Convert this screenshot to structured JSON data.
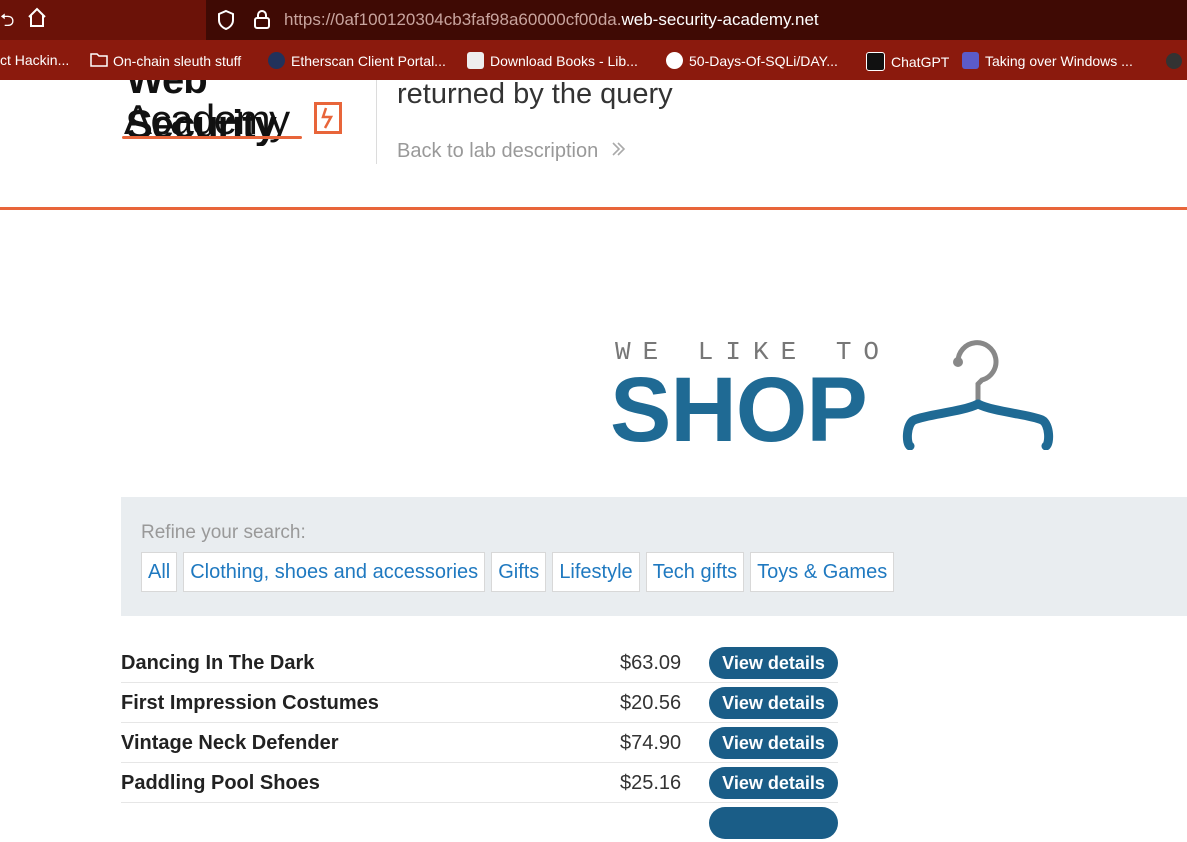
{
  "browser": {
    "url_prefix": "https://0af100120304cb3faf98a60000cf00da.",
    "url_domain": "web-security-academy.net",
    "bookmarks": [
      {
        "label": "ct Hackin...",
        "icon": "none"
      },
      {
        "label": "On-chain sleuth stuff",
        "icon": "folder-icon"
      },
      {
        "label": "Etherscan Client Portal...",
        "icon": "etherscan-icon"
      },
      {
        "label": "Download Books - Lib...",
        "icon": "library-icon"
      },
      {
        "label": "50-Days-Of-SQLi/DAY...",
        "icon": "github-icon"
      },
      {
        "label": "ChatGPT",
        "icon": "chatgpt-icon"
      },
      {
        "label": "Taking over Windows ...",
        "icon": "bookmark-site-icon"
      }
    ]
  },
  "header": {
    "logo_line1": "Web Security",
    "logo_line2": "Academy",
    "lab_title": "returned by the query",
    "back_link": "Back to lab description",
    "back_link_icon": "double-chevron-right-icon"
  },
  "banner": {
    "tagline": "WE LIKE TO",
    "shop": "SHOP"
  },
  "filters": {
    "label": "Refine your search:",
    "categories": [
      "All",
      "Clothing, shoes and accessories",
      "Gifts",
      "Lifestyle",
      "Tech gifts",
      "Toys & Games"
    ]
  },
  "products": [
    {
      "name": "Dancing In The Dark",
      "price": "$63.09",
      "button": "View details"
    },
    {
      "name": "First Impression Costumes",
      "price": "$20.56",
      "button": "View details"
    },
    {
      "name": "Vintage Neck Defender",
      "price": "$74.90",
      "button": "View details"
    },
    {
      "name": "Paddling Pool Shoes",
      "price": "$25.16",
      "button": "View details"
    }
  ],
  "colors": {
    "accent_orange": "#e8653a",
    "brand_blue": "#1f6a94",
    "button_blue": "#1a5d87",
    "link_blue": "#1f79c0",
    "browser_bar": "#6b1208"
  }
}
